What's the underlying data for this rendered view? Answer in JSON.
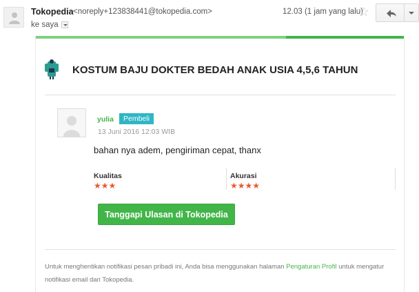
{
  "email_header": {
    "sender_name": "Tokopedia",
    "sender_email": "<noreply+123838441@tokopedia.com>",
    "recipient": "ke saya",
    "timestamp": "12.03 (1 jam yang lalu)"
  },
  "product": {
    "title": "KOSTUM BAJU DOKTER BEDAH ANAK USIA 4,5,6 TAHUN"
  },
  "review": {
    "reviewer_name": "yulia",
    "badge": "Pembeli",
    "date": "13 Juni 2016 12:03 WIB",
    "text": "bahan nya adem, pengiriman cepat, thanx",
    "ratings": [
      {
        "label": "Kualitas",
        "stars": "★★★",
        "value": 3
      },
      {
        "label": "Akurasi",
        "stars": "★★★★",
        "value": 4
      }
    ]
  },
  "cta": {
    "label": "Tanggapi Ulasan di Tokopedia"
  },
  "footer": {
    "text_before": "Untuk menghentikan notifikasi pesan pribadi ini, Anda bisa menggunakan halaman ",
    "link": "Pengaturan Profil",
    "text_after": " untuk mengatur notifikasi email dari Tokopedia."
  },
  "colors": {
    "brand_green": "#42b549",
    "badge_teal": "#2fb6c5",
    "star_orange": "#e75a2e"
  },
  "icons": {
    "sender_avatar": "person-silhouette-icon",
    "star": "star-outline-icon",
    "reply": "reply-arrow-icon",
    "more": "chevron-down-icon",
    "product": "doctor-costume-thumbnail",
    "reviewer_avatar": "person-silhouette-icon"
  }
}
